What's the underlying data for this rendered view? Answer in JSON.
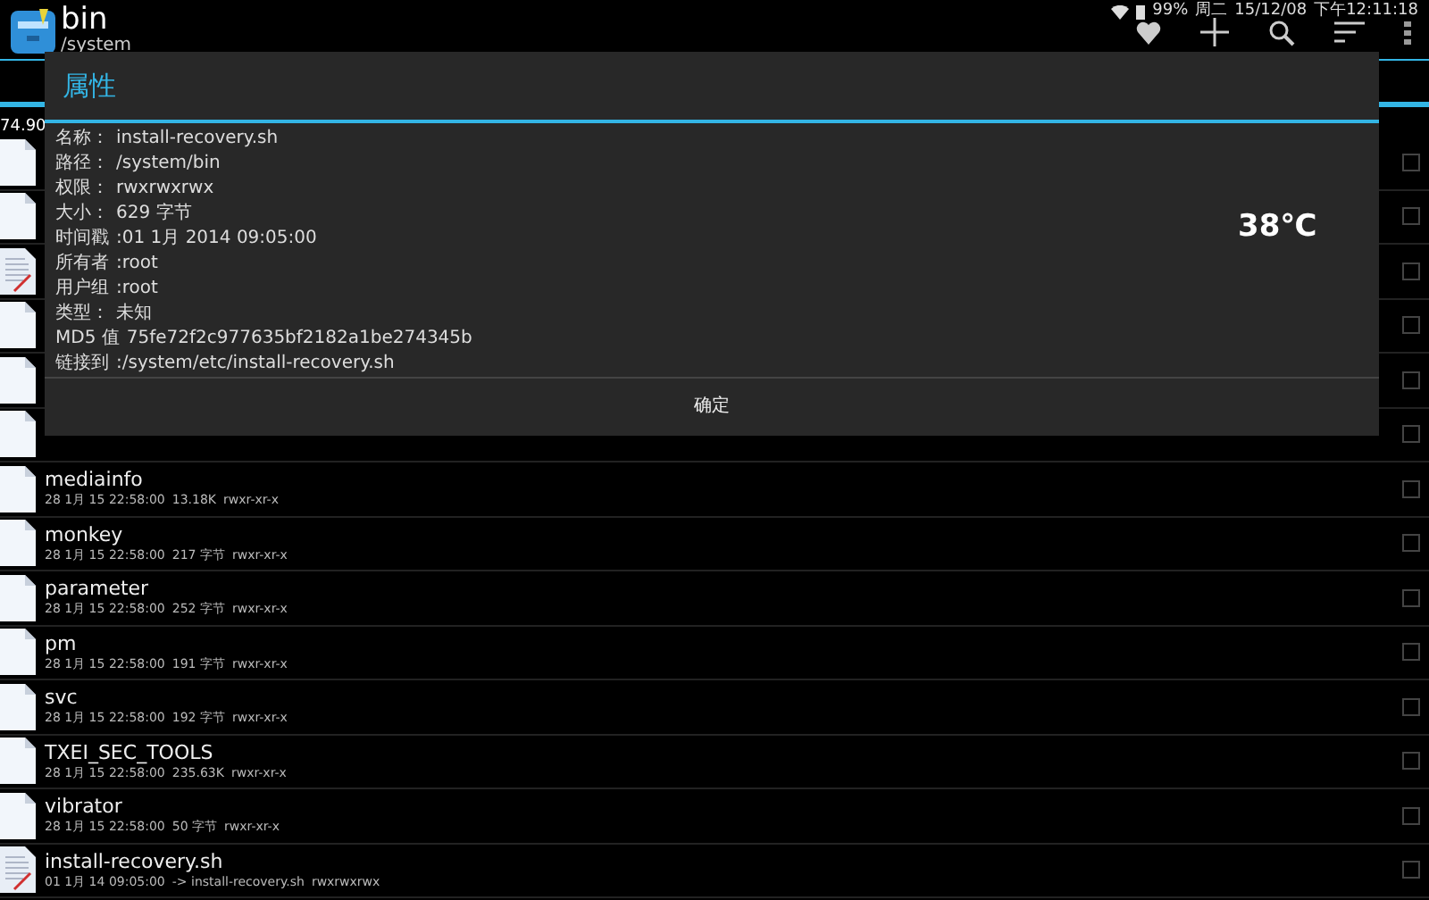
{
  "app_bar": {
    "title": "bin",
    "subtitle": "/system"
  },
  "status_bar": {
    "battery": "99%",
    "weekday": "周二",
    "date": "15/12/08",
    "time": "下午12:11:18"
  },
  "storage_text": "74.90",
  "files": [
    {
      "kind": "file",
      "checked": false
    },
    {
      "kind": "file",
      "checked": false
    },
    {
      "kind": "script",
      "checked": false
    },
    {
      "kind": "file",
      "checked": false
    },
    {
      "kind": "file",
      "checked": false
    },
    {
      "kind": "file",
      "checked": false
    },
    {
      "kind": "file",
      "checked": false,
      "name": "mediainfo",
      "date": "28 1月 15 22:58:00",
      "size": "13.18K",
      "perms": "rwxr-xr-x"
    },
    {
      "kind": "file",
      "checked": false,
      "name": "monkey",
      "date": "28 1月 15 22:58:00",
      "size": "217 字节",
      "perms": "rwxr-xr-x"
    },
    {
      "kind": "file",
      "checked": false,
      "name": "parameter",
      "date": "28 1月 15 22:58:00",
      "size": "252 字节",
      "perms": "rwxr-xr-x"
    },
    {
      "kind": "file",
      "checked": false,
      "name": "pm",
      "date": "28 1月 15 22:58:00",
      "size": "191 字节",
      "perms": "rwxr-xr-x"
    },
    {
      "kind": "file",
      "checked": false,
      "name": "svc",
      "date": "28 1月 15 22:58:00",
      "size": "192 字节",
      "perms": "rwxr-xr-x"
    },
    {
      "kind": "file",
      "checked": false,
      "name": "TXEI_SEC_TOOLS",
      "date": "28 1月 15 22:58:00",
      "size": "235.63K",
      "perms": "rwxr-xr-x"
    },
    {
      "kind": "file",
      "checked": false,
      "name": "vibrator",
      "date": "28 1月 15 22:58:00",
      "size": "50 字节",
      "perms": "rwxr-xr-x"
    },
    {
      "kind": "script",
      "checked": false,
      "name": "install-recovery.sh",
      "date": "01 1月 14 09:05:00",
      "size": "-> install-recovery.sh",
      "perms": "rwxrwxrwx"
    }
  ],
  "dialog": {
    "title": "属性",
    "properties": [
      {
        "label": "名称：",
        "value": "install-recovery.sh"
      },
      {
        "label": "路径：",
        "value": "/system/bin"
      },
      {
        "label": "权限：",
        "value": "rwxrwxrwx"
      },
      {
        "label": "大小：",
        "value": "629 字节"
      },
      {
        "label": "时间戳",
        "value": ":01 1月 2014 09:05:00"
      },
      {
        "label": "所有者",
        "value": ":root"
      },
      {
        "label": "用户组",
        "value": ":root"
      },
      {
        "label": "类型：",
        "value": "未知"
      },
      {
        "label": "MD5 值",
        "value": "75fe72f2c977635bf2182a1be274345b"
      },
      {
        "label": "链接到",
        "value": ":/system/etc/install-recovery.sh"
      }
    ],
    "temperature": "38℃",
    "button": "确定"
  }
}
